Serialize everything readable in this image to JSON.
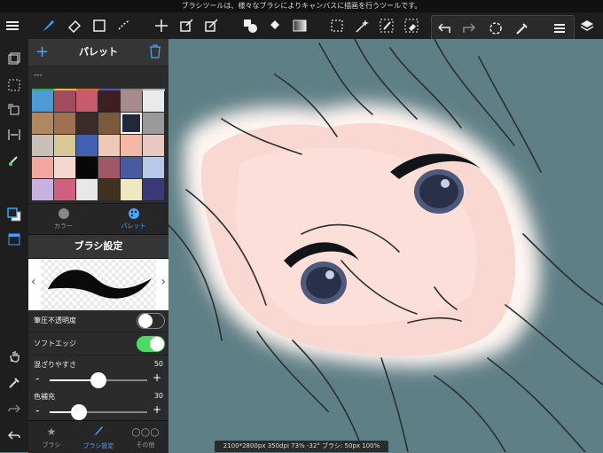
{
  "tip": "ブラシツールは、様々なブラシによりキャンバスに描画を行うツールです。",
  "palette": {
    "title": "パレット",
    "name": "---",
    "strip": [
      "#3aa84a",
      "#e0c030",
      "#d07020",
      "#4060c0",
      "#888888",
      "#b0b0b0"
    ],
    "colors": [
      "#4d9bd6",
      "#a24b5e",
      "#c85a6e",
      "#3d1f22",
      "#a88c8c",
      "#eaeaea",
      "#b08860",
      "#a07050",
      "#3a2c28",
      "#7a5a3a",
      "#22283a",
      "#9a9a9a",
      "#c8c0b8",
      "#d8c898",
      "#4060b8",
      "#f0c8b8",
      "#f4b8a8",
      "#e8c8c0",
      "#f0a8a0",
      "#f4d8d0",
      "#080808",
      "#a05868",
      "#4a5aa0",
      "#b8c8e8",
      "#c8b0e0",
      "#d06080",
      "#e8e8e8",
      "#403020",
      "#f0e8c0",
      "#3a3a78"
    ],
    "selected_index": 10
  },
  "color_tabs": [
    {
      "label": "カラー",
      "icon": "color-wheel-icon"
    },
    {
      "label": "パレット",
      "icon": "palette-icon"
    }
  ],
  "brush_settings": {
    "title": "ブラシ設定",
    "pressure_opacity": {
      "label": "筆圧不透明度",
      "on": false
    },
    "soft_edge": {
      "label": "ソフトエッジ",
      "on": true
    },
    "blend": {
      "label": "混ざりやすさ",
      "value": "50",
      "fraction": 0.5
    },
    "color_fill": {
      "label": "色補充",
      "value": "30",
      "fraction": 0.3
    }
  },
  "bottom_tabs": [
    {
      "label": "ブラシ",
      "icon": "star-icon"
    },
    {
      "label": "ブラシ設定",
      "icon": "brush-icon"
    },
    {
      "label": "その他",
      "icon": "more-icon"
    }
  ],
  "status": "2100*2800px 350dpi 73% -32° ブラシ: 50px 100%",
  "colors": {
    "accent": "#4aa3ff",
    "toggle_on": "#4cd964",
    "canvas_bg": "#5f7f86"
  }
}
